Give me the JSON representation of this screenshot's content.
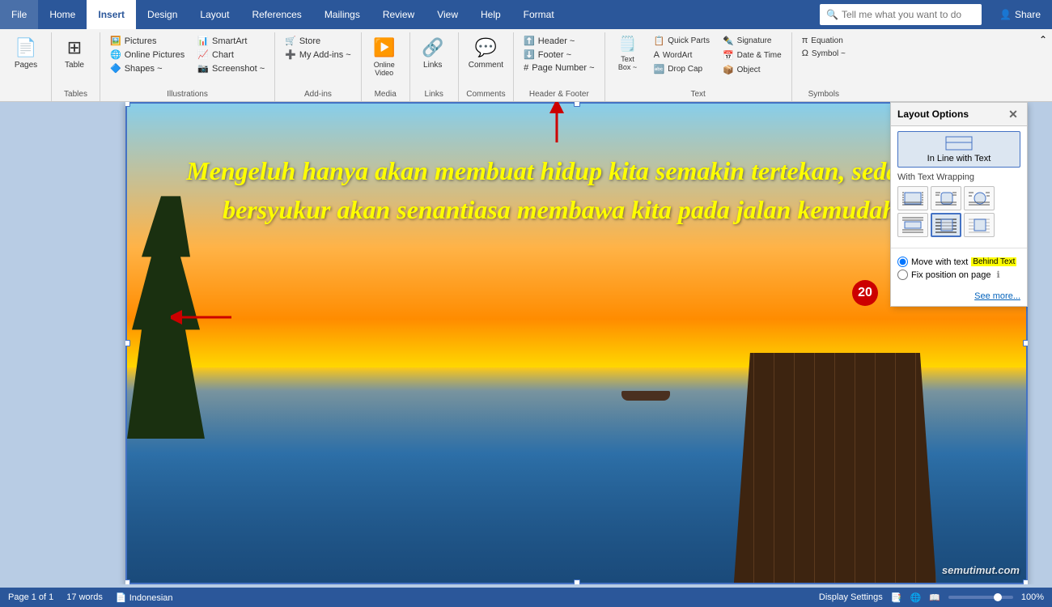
{
  "tabs": [
    {
      "label": "File",
      "active": false
    },
    {
      "label": "Home",
      "active": false
    },
    {
      "label": "Insert",
      "active": true
    },
    {
      "label": "Design",
      "active": false
    },
    {
      "label": "Layout",
      "active": false
    },
    {
      "label": "References",
      "active": false
    },
    {
      "label": "Mailings",
      "active": false
    },
    {
      "label": "Review",
      "active": false
    },
    {
      "label": "View",
      "active": false
    },
    {
      "label": "Help",
      "active": false
    },
    {
      "label": "Format",
      "active": false
    }
  ],
  "search": {
    "placeholder": "Tell me what you want to do"
  },
  "share_label": "Share",
  "ribbon": {
    "groups": [
      {
        "label": "Pages",
        "items": [
          {
            "icon": "📄",
            "label": "Pages"
          }
        ]
      },
      {
        "label": "Tables",
        "items": [
          {
            "icon": "⊞",
            "label": "Table"
          }
        ]
      },
      {
        "label": "Illustrations",
        "items": [
          {
            "label": "Pictures"
          },
          {
            "label": "Online Pictures"
          },
          {
            "label": "Shapes ~"
          },
          {
            "label": "SmartArt"
          },
          {
            "label": "Chart"
          },
          {
            "label": "Screenshot ~"
          }
        ]
      },
      {
        "label": "Add-ins",
        "items": [
          {
            "label": "Store"
          },
          {
            "label": "My Add-ins ~"
          }
        ]
      },
      {
        "label": "Media",
        "items": [
          {
            "label": "Online Video"
          }
        ]
      },
      {
        "label": "Links",
        "items": [
          {
            "label": "Links"
          }
        ]
      },
      {
        "label": "Comments",
        "items": [
          {
            "label": "Comment"
          }
        ]
      },
      {
        "label": "Header & Footer",
        "items": [
          {
            "label": "Header ~"
          },
          {
            "label": "Footer ~"
          },
          {
            "label": "Page Number ~"
          }
        ]
      },
      {
        "label": "Text",
        "items": [
          {
            "label": "Text Box ~"
          },
          {
            "label": "Quick Parts"
          },
          {
            "label": "WordArt"
          },
          {
            "label": "Drop Cap"
          },
          {
            "label": "Signature Line"
          },
          {
            "label": "Date & Time"
          },
          {
            "label": "Object"
          }
        ]
      },
      {
        "label": "Symbols",
        "items": [
          {
            "label": "Equation"
          },
          {
            "label": "Symbol ~"
          }
        ]
      }
    ]
  },
  "quote": "Mengeluh hanya akan membuat hidup kita semakin tertekan, sedangkan bersyukur akan senantiasa membawa kita pada jalan kemudahan.",
  "watermark": "semutimut.com",
  "badge_number": "20",
  "layout_panel": {
    "title": "Layout Options",
    "inline_label": "In Line with Text",
    "wrapping_label": "With Text Wrapping",
    "radio1": "Move with text",
    "radio2": "Fix position on page",
    "highlight": "Behind Text",
    "see_more": "See more..."
  },
  "status_bar": {
    "page": "Page 1 of 1",
    "words": "17 words",
    "language": "Indonesian",
    "display": "Display Settings",
    "zoom": "100%"
  }
}
